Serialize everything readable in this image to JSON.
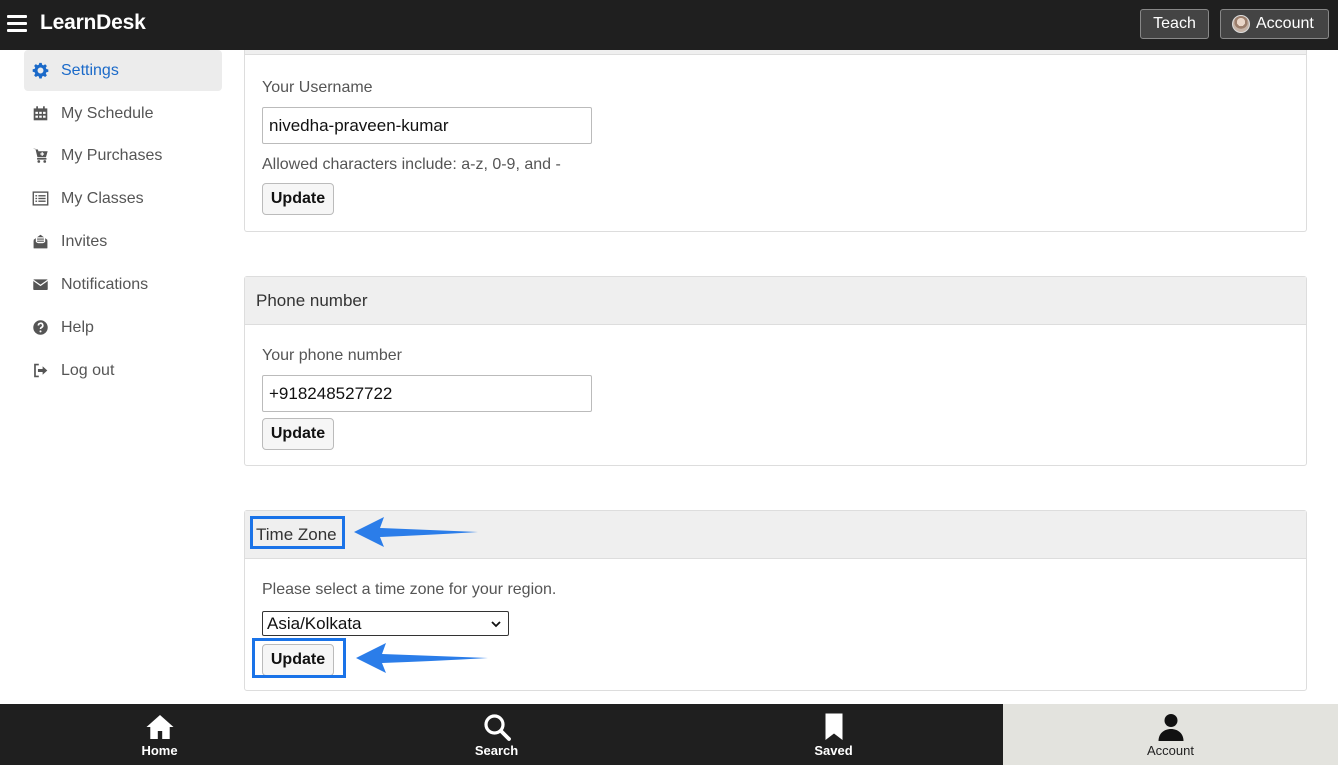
{
  "app": {
    "brand": "LearnDesk"
  },
  "topbar": {
    "teach_label": "Teach",
    "account_label": "Account"
  },
  "sidebar": {
    "items": [
      {
        "label": "Settings",
        "icon": "gear-icon",
        "active": true
      },
      {
        "label": "My Schedule",
        "icon": "calendar-icon"
      },
      {
        "label": "My Purchases",
        "icon": "cart-icon"
      },
      {
        "label": "My Classes",
        "icon": "list-icon"
      },
      {
        "label": "Invites",
        "icon": "envelope-open-icon"
      },
      {
        "label": "Notifications",
        "icon": "envelope-icon"
      },
      {
        "label": "Help",
        "icon": "question-icon"
      },
      {
        "label": "Log out",
        "icon": "logout-icon"
      }
    ]
  },
  "username_card": {
    "label": "Your Username",
    "value": "nivedha-praveen-kumar",
    "hint": "Allowed characters include: a-z, 0-9, and -",
    "button": "Update"
  },
  "phone_card": {
    "title": "Phone number",
    "label": "Your phone number",
    "value": "+918248527722",
    "button": "Update"
  },
  "timezone_card": {
    "title": "Time Zone",
    "label": "Please select a time zone for your region.",
    "selected": "Asia/Kolkata",
    "button": "Update"
  },
  "bottom_nav": {
    "items": [
      {
        "label": "Home",
        "icon": "home-icon"
      },
      {
        "label": "Search",
        "icon": "search-icon"
      },
      {
        "label": "Saved",
        "icon": "bookmark-icon"
      },
      {
        "label": "Account",
        "icon": "user-icon",
        "active": true
      }
    ]
  },
  "colors": {
    "accent": "#1b6ac9",
    "annotation": "#1a73e8",
    "topbar": "#1f1f1f"
  }
}
